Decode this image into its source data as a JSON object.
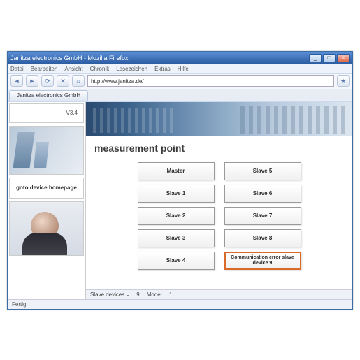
{
  "window": {
    "title": "Janitza electronics GmbH - Mozilla Firefox",
    "min": "_",
    "max": "□",
    "close": "×"
  },
  "menu": {
    "items": [
      "Datei",
      "Bearbeiten",
      "Ansicht",
      "Chronik",
      "Lesezeichen",
      "Extras",
      "Hilfe"
    ]
  },
  "nav": {
    "back": "◄",
    "forward": "►",
    "reload": "⟳",
    "stop": "✕",
    "home": "⌂",
    "url": "http://www.janitza.de/",
    "favicon": "★"
  },
  "tab": {
    "label": "Janitza electronics GmbH"
  },
  "sidebar": {
    "version": "V3.4",
    "homepage_link": "goto device homepage"
  },
  "page": {
    "title": "measurement point"
  },
  "devices": {
    "col1": [
      {
        "label": "Master"
      },
      {
        "label": "Slave 1"
      },
      {
        "label": "Slave 2"
      },
      {
        "label": "Slave 3"
      },
      {
        "label": "Slave 4"
      }
    ],
    "col2": [
      {
        "label": "Slave 5"
      },
      {
        "label": "Slave 6"
      },
      {
        "label": "Slave 7"
      },
      {
        "label": "Slave 8"
      },
      {
        "label": "Communication error slave device 9",
        "error": true
      }
    ]
  },
  "footer": {
    "slave_label": "Slave devices =",
    "slave_count": "9",
    "mode_label": "Mode:",
    "mode_value": "1"
  },
  "status": {
    "text": "Fertig"
  }
}
